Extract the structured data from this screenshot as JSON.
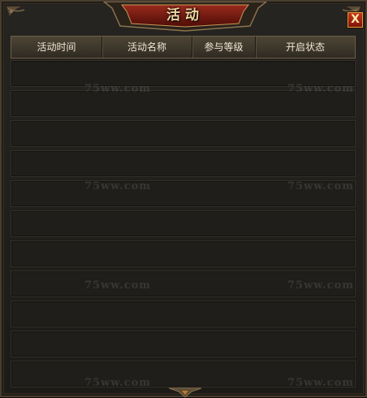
{
  "window": {
    "title": "活动",
    "close_label": "X"
  },
  "table": {
    "columns": [
      "活动时间",
      "活动名称",
      "参与等级",
      "开启状态"
    ],
    "row_count": 11
  },
  "watermark": {
    "text": "75ww.com"
  },
  "colors": {
    "title_plaque": "#7a1a12",
    "title_text": "#f0d6a0",
    "close_button": "#b02a14",
    "header_bg": "#4e4536",
    "row_bg": "#1f1e1b"
  }
}
